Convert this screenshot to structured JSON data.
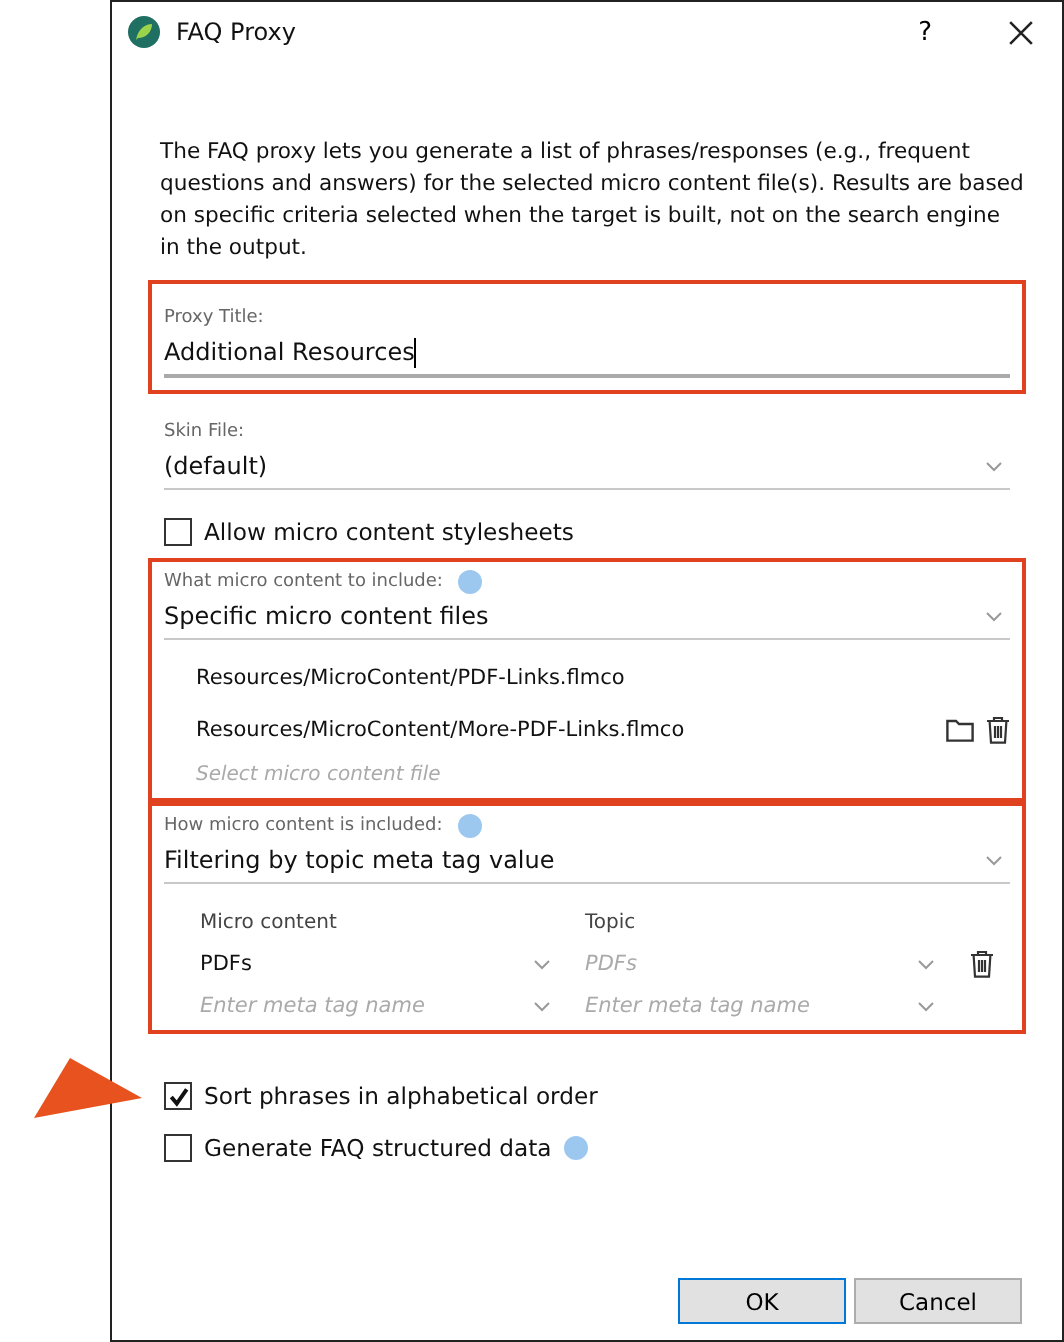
{
  "window": {
    "title": "FAQ Proxy",
    "help": "?"
  },
  "description": "The FAQ proxy lets you generate a list of phrases/responses (e.g., frequent questions and answers) for the selected micro content file(s). Results are based on specific criteria selected when the target is built, not on the search engine in the output.",
  "proxy_title": {
    "label": "Proxy Title:",
    "value": "Additional Resources",
    "highlighted": true
  },
  "skin_file": {
    "label": "Skin File:",
    "value": "(default)",
    "highlighted": false
  },
  "allow_stylesheets": {
    "label": "Allow micro content stylesheets",
    "checked": false
  },
  "content_include": {
    "label": "What micro content to include:",
    "value": "Specific micro content files",
    "highlighted": true,
    "files": [
      {
        "path": "Resources/MicroContent/PDF-Links.flmco",
        "hovered": false
      },
      {
        "path": "Resources/MicroContent/More-PDF-Links.flmco",
        "hovered": true
      }
    ],
    "placeholder": "Select micro content file"
  },
  "filter": {
    "label": "How micro content is included:",
    "value": "Filtering by topic meta tag value",
    "highlighted": true,
    "columns": [
      "Micro content",
      "Topic"
    ],
    "rows": [
      {
        "micro_content": "PDFs",
        "topic_placeholder": "PDFs"
      }
    ],
    "placeholders": [
      "Enter meta tag name",
      "Enter meta tag name"
    ]
  },
  "options": [
    {
      "label": "Sort phrases in alphabetical order",
      "checked": true,
      "info": false,
      "pointer": true
    },
    {
      "label": "Generate FAQ structured data",
      "checked": false,
      "info": true,
      "pointer": false
    }
  ],
  "buttons": [
    {
      "label": "OK",
      "default": true
    },
    {
      "label": "Cancel",
      "default": false
    }
  ]
}
